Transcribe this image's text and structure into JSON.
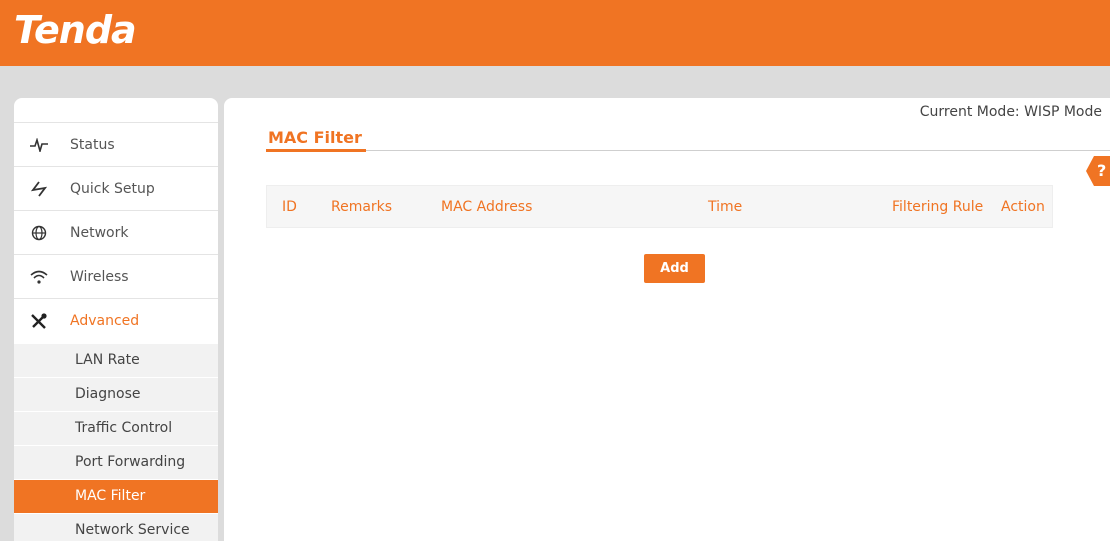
{
  "brand": {
    "logo_text": "Tenda",
    "accent_color": "#f07423"
  },
  "mode": {
    "label": "Current Mode: WISP Mode"
  },
  "sidebar": {
    "items": [
      {
        "label": "Status",
        "icon": "pulse-icon"
      },
      {
        "label": "Quick Setup",
        "icon": "lightning-icon"
      },
      {
        "label": "Network",
        "icon": "globe-icon"
      },
      {
        "label": "Wireless",
        "icon": "wifi-icon"
      },
      {
        "label": "Advanced",
        "icon": "tools-icon",
        "active": true
      }
    ],
    "submenu": [
      {
        "label": "LAN Rate"
      },
      {
        "label": "Diagnose"
      },
      {
        "label": "Traffic Control"
      },
      {
        "label": "Port Forwarding"
      },
      {
        "label": "MAC Filter",
        "active": true
      },
      {
        "label": "Network Service"
      }
    ]
  },
  "main": {
    "title": "MAC Filter",
    "help_label": "?",
    "table": {
      "columns": [
        "ID",
        "Remarks",
        "MAC Address",
        "Time",
        "Filtering Rule",
        "Action"
      ],
      "rows": []
    },
    "add_label": "Add"
  }
}
